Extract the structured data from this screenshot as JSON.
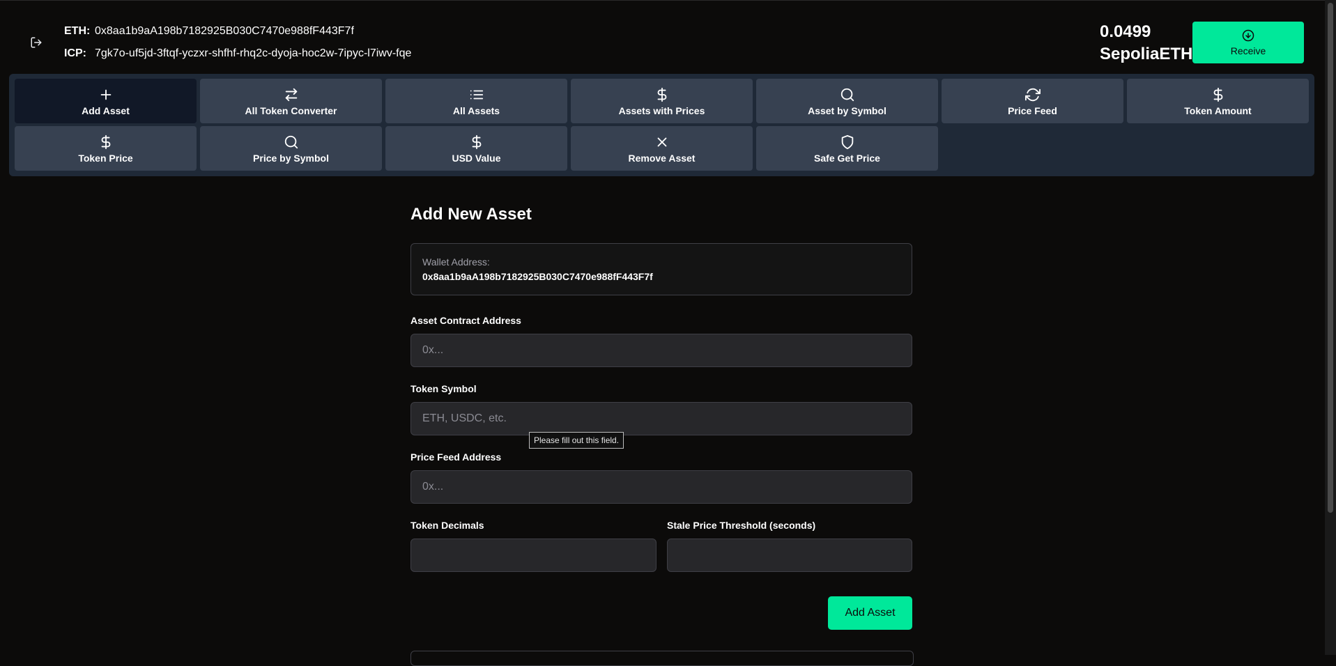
{
  "header": {
    "eth_label": "ETH:",
    "eth_address": "0x8aa1b9aA198b7182925B030C7470e988fF443F7f",
    "icp_label": "ICP:",
    "icp_principal": "7gk7o-uf5jd-3ftqf-yczxr-shfhf-rhq2c-dyoja-hoc2w-7ipyc-l7iwv-fqe",
    "balance_amount": "0.0499",
    "balance_unit": "SepoliaETH",
    "receive_label": "Receive"
  },
  "nav": {
    "items": [
      {
        "label": "Add Asset",
        "icon": "plus-icon"
      },
      {
        "label": "All Token Converter",
        "icon": "swap-arrows-icon"
      },
      {
        "label": "All Assets",
        "icon": "list-icon"
      },
      {
        "label": "Assets with Prices",
        "icon": "dollar-icon"
      },
      {
        "label": "Asset by Symbol",
        "icon": "search-icon"
      },
      {
        "label": "Price Feed",
        "icon": "refresh-icon"
      },
      {
        "label": "Token Amount",
        "icon": "dollar-icon"
      },
      {
        "label": "Token Price",
        "icon": "dollar-icon"
      },
      {
        "label": "Price by Symbol",
        "icon": "search-icon"
      },
      {
        "label": "USD Value",
        "icon": "dollar-icon"
      },
      {
        "label": "Remove Asset",
        "icon": "close-icon"
      },
      {
        "label": "Safe Get Price",
        "icon": "shield-icon"
      }
    ],
    "active": "Add Asset"
  },
  "form": {
    "title": "Add New Asset",
    "wallet_label": "Wallet Address:",
    "wallet_value": "0x8aa1b9aA198b7182925B030C7470e988fF443F7f",
    "contract_label": "Asset Contract Address",
    "contract_placeholder": "0x...",
    "symbol_label": "Token Symbol",
    "symbol_placeholder": "ETH, USDC, etc.",
    "validation_tooltip": "Please fill out this field.",
    "pricefeed_label": "Price Feed Address",
    "pricefeed_placeholder": "0x...",
    "decimals_label": "Token Decimals",
    "decimals_value": "",
    "stale_label": "Stale Price Threshold (seconds)",
    "stale_value": "",
    "submit_label": "Add Asset"
  }
}
